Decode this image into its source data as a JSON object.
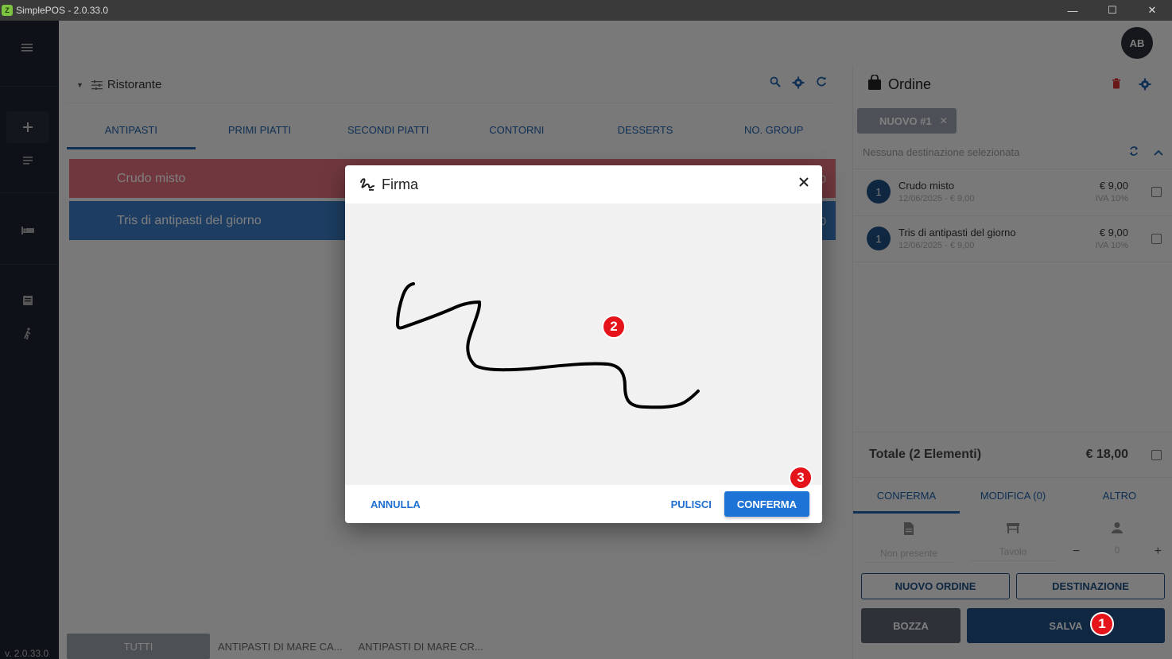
{
  "window": {
    "title": "SimplePOS - 2.0.33.0",
    "logo_text": "Z",
    "minimize": "—",
    "maximize": "☐",
    "close": "✕"
  },
  "sidebar": {
    "version": "v. 2.0.33.0"
  },
  "user": {
    "initials": "AB"
  },
  "menu": {
    "title": "Ristorante",
    "tabs": [
      "ANTIPASTI",
      "PRIMI PIATTI",
      "SECONDI PIATTI",
      "CONTORNI",
      "DESSERTS",
      "NO. GROUP"
    ],
    "products": [
      {
        "name": "Crudo misto",
        "price_visible": "0",
        "color": "#e0707c"
      },
      {
        "name": "Tris di antipasti del giorno",
        "price_visible": "0",
        "color": "#3a7dc4"
      }
    ],
    "subcategories": [
      "TUTTI",
      "ANTIPASTI DI MARE CA...",
      "ANTIPASTI DI MARE CR..."
    ]
  },
  "order": {
    "title": "Ordine",
    "chip": "NUOVO #1",
    "chip_close": "✕",
    "destination": "Nessuna destinazione selezionata",
    "items": [
      {
        "qty": "1",
        "name": "Crudo misto",
        "sub": "12/06/2025 - € 9,00",
        "amount": "€ 9,00",
        "vat": "IVA 10%"
      },
      {
        "qty": "1",
        "name": "Tris di antipasti del giorno",
        "sub": "12/06/2025 - € 9,00",
        "amount": "€ 9,00",
        "vat": "IVA 10%"
      }
    ],
    "total_label": "Totale (2 Elementi)",
    "total_amount": "€ 18,00",
    "tabs": [
      "CONFERMA",
      "MODIFICA (0)",
      "ALTRO"
    ],
    "meta": {
      "document": "Non presente",
      "table": "Tavolo",
      "covers": "0",
      "minus": "−",
      "plus": "+"
    },
    "buttons": {
      "new_order": "NUOVO ORDINE",
      "destination": "DESTINAZIONE",
      "draft": "BOZZA",
      "save": "SALVA"
    }
  },
  "dialog": {
    "title": "Firma",
    "cancel": "ANNULLA",
    "clear": "PULISCI",
    "confirm": "CONFERMA"
  },
  "markers": [
    "1",
    "2",
    "3"
  ],
  "colors": {
    "accent": "#1e5fa8",
    "primary_button": "#1e73d6",
    "marker": "#e4141a",
    "sidebar": "#1d2430"
  }
}
